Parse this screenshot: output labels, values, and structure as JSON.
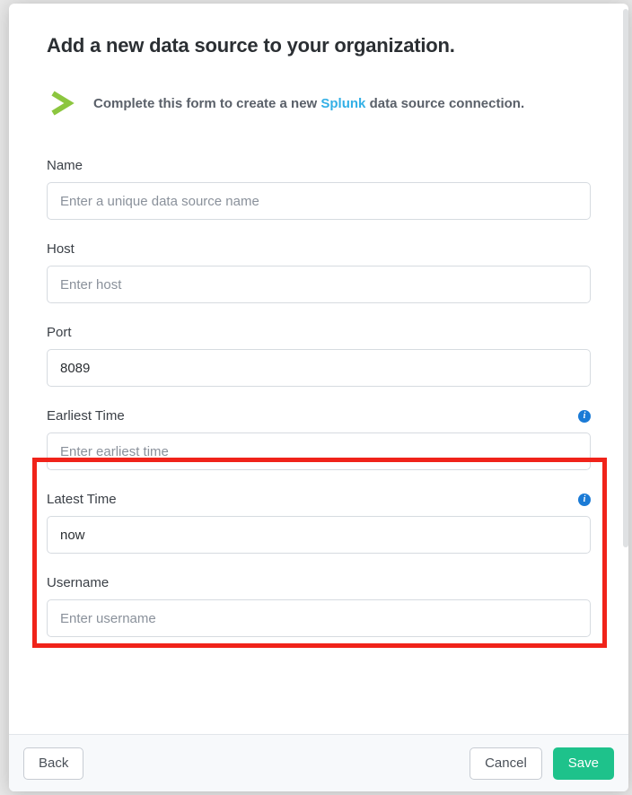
{
  "modal": {
    "title": "Add a new data source to your organization.",
    "info_prefix": "Complete this form to create a new ",
    "info_link": "Splunk",
    "info_suffix": " data source connection."
  },
  "fields": {
    "name": {
      "label": "Name",
      "placeholder": "Enter a unique data source name",
      "value": ""
    },
    "host": {
      "label": "Host",
      "placeholder": "Enter host",
      "value": ""
    },
    "port": {
      "label": "Port",
      "placeholder": "",
      "value": "8089"
    },
    "earliest": {
      "label": "Earliest Time",
      "placeholder": "Enter earliest time",
      "value": ""
    },
    "latest": {
      "label": "Latest Time",
      "placeholder": "",
      "value": "now"
    },
    "username": {
      "label": "Username",
      "placeholder": "Enter username",
      "value": ""
    }
  },
  "footer": {
    "back": "Back",
    "cancel": "Cancel",
    "save": "Save"
  },
  "colors": {
    "accent_green": "#8CC63F",
    "link_blue": "#33b0e6",
    "save_green": "#1ec28b",
    "highlight_red": "#f0231a",
    "info_blue": "#1b7bd6"
  }
}
